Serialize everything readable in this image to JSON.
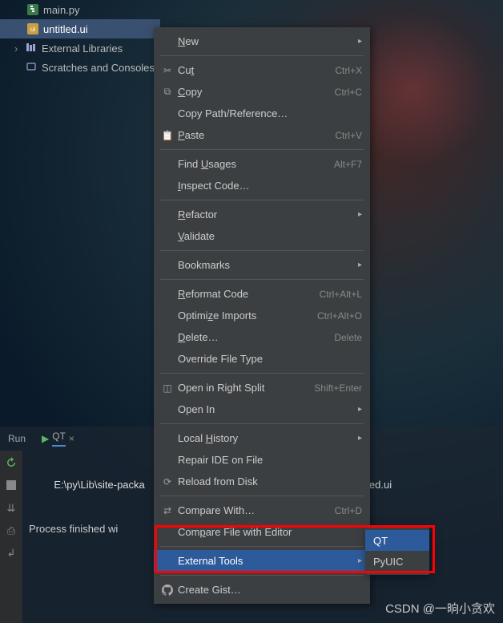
{
  "tree": {
    "main_py": "main.py",
    "untitled_ui": "untitled.ui",
    "ext_lib": "External Libraries",
    "scratches": "Scratches and Consoles"
  },
  "menu": {
    "new": "New",
    "cut": "Cut",
    "cut_k": "Ctrl+X",
    "copy": "Copy",
    "copy_k": "Ctrl+C",
    "copy_path": "Copy Path/Reference…",
    "paste": "Paste",
    "paste_k": "Ctrl+V",
    "find_usages": "Find Usages",
    "find_usages_k": "Alt+F7",
    "inspect": "Inspect Code…",
    "refactor": "Refactor",
    "validate": "Validate",
    "bookmarks": "Bookmarks",
    "reformat": "Reformat Code",
    "reformat_k": "Ctrl+Alt+L",
    "optimize": "Optimize Imports",
    "optimize_k": "Ctrl+Alt+O",
    "delete": "Delete…",
    "delete_k": "Delete",
    "override": "Override File Type",
    "split": "Open in Right Split",
    "split_k": "Shift+Enter",
    "open_in": "Open In",
    "history": "Local History",
    "repair": "Repair IDE on File",
    "reload": "Reload from Disk",
    "compare": "Compare With…",
    "compare_k": "Ctrl+D",
    "compare_editor": "Compare File with Editor",
    "ext_tools": "External Tools",
    "create_gist": "Create Gist…"
  },
  "submenu": {
    "qt": "QT",
    "pyuic": "PyUIC"
  },
  "bottom": {
    "run": "Run",
    "qt": "QT",
    "path_line": "E:\\py\\Lib\\site-packa",
    "path_suffix": "led.ui",
    "finished": "Process finished wi"
  },
  "watermark": "CSDN @一晌小贪欢"
}
